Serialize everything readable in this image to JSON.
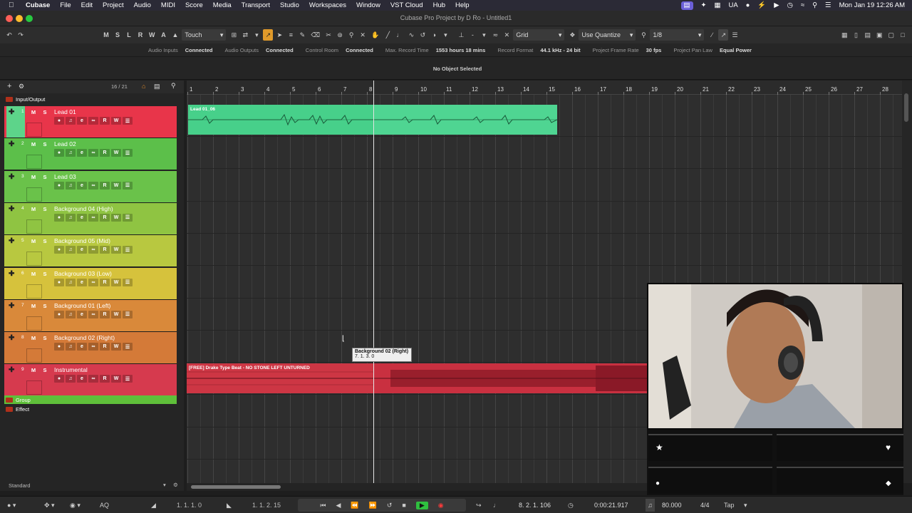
{
  "menubar": {
    "app": "Cubase",
    "items": [
      "File",
      "Edit",
      "Project",
      "Audio",
      "MIDI",
      "Score",
      "Media",
      "Transport",
      "Studio",
      "Workspaces",
      "Window",
      "VST Cloud",
      "Hub",
      "Help"
    ],
    "input_source": "UA",
    "datetime": "Mon Jan 19  12:26 AM"
  },
  "window": {
    "title": "Cubase Pro Project by D Ro - Untitled1"
  },
  "toolbar": {
    "state_buttons": [
      "M",
      "S",
      "L",
      "R",
      "W",
      "A"
    ],
    "automation_mode": "Touch",
    "snap_type": "Grid",
    "quantize_mode": "Use Quantize",
    "quantize_value": "1/8"
  },
  "status": [
    {
      "label": "Audio Inputs",
      "value": "Connected"
    },
    {
      "label": "Audio Outputs",
      "value": "Connected"
    },
    {
      "label": "Control Room",
      "value": "Connected"
    },
    {
      "label": "Max. Record Time",
      "value": "1553 hours 18 mins"
    },
    {
      "label": "Record Format",
      "value": "44.1 kHz - 24 bit"
    },
    {
      "label": "Project Frame Rate",
      "value": "30 fps"
    },
    {
      "label": "Project Pan Law",
      "value": "Equal Power"
    }
  ],
  "infoline": "No Object Selected",
  "tracklist": {
    "count": "16 / 21",
    "input_output": "Input/Output",
    "group": "Group",
    "effect": "Effect",
    "footer": "Standard",
    "tracks": [
      {
        "num": "1",
        "name": "Lead 01",
        "color": "#e8354a",
        "numcolor": "#5dd48a"
      },
      {
        "num": "2",
        "name": "Lead 02",
        "color": "#5cbf4a",
        "numcolor": "#5cbf4a"
      },
      {
        "num": "3",
        "name": "Lead 03",
        "color": "#6ac24a",
        "numcolor": "#6ac24a"
      },
      {
        "num": "4",
        "name": "Background 04 (High)",
        "color": "#8fc442",
        "numcolor": "#8fc442"
      },
      {
        "num": "5",
        "name": "Background 05 (Mid)",
        "color": "#b8c840",
        "numcolor": "#b8c840"
      },
      {
        "num": "6",
        "name": "Background 03 (Low)",
        "color": "#d6c23c",
        "numcolor": "#d6c23c"
      },
      {
        "num": "7",
        "name": "Background 01 (Left)",
        "color": "#d9893a",
        "numcolor": "#d9893a"
      },
      {
        "num": "8",
        "name": "Background 02 (Right)",
        "color": "#d47a38",
        "numcolor": "#d47a38"
      },
      {
        "num": "9",
        "name": "Instrumental",
        "color": "#d63a4e",
        "numcolor": "#d63a4e"
      }
    ]
  },
  "ruler": [
    "1",
    "2",
    "3",
    "4",
    "5",
    "6",
    "7",
    "8",
    "9",
    "10",
    "11",
    "12",
    "13",
    "14",
    "15",
    "16",
    "17",
    "18",
    "19",
    "20",
    "21",
    "22",
    "23",
    "24",
    "25",
    "26",
    "27",
    "28"
  ],
  "events": {
    "lead": "Lead 01_06",
    "instrumental": "[FREE] Drake Type Beat - NO STONE LEFT UNTURNED"
  },
  "tooltip": {
    "track": "Background 02 (Right)",
    "position": "7. 1. 3.   0"
  },
  "transport": {
    "left_locator": "1.  1.  1.     0",
    "right_locator": "1.  1.  2.   15",
    "position_bars": "8.  2.  1. 106",
    "position_time": "0:00:21.917",
    "signature": "4/4",
    "tempo": "80.000",
    "tap": "Tap",
    "aq": "AQ"
  }
}
